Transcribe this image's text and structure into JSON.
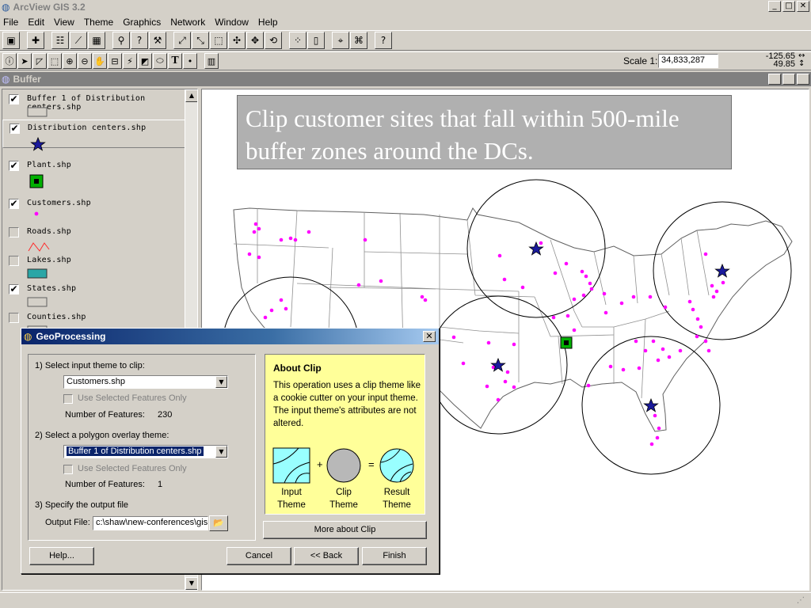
{
  "app": {
    "title": "ArcView GIS 3.2"
  },
  "menu": [
    "File",
    "Edit",
    "View",
    "Theme",
    "Graphics",
    "Network",
    "Window",
    "Help"
  ],
  "toolbar": {
    "scale_label": "Scale 1:",
    "scale_value": "34,833,287",
    "coord_x": "-125.65",
    "coord_y": "49.85"
  },
  "view": {
    "title": "Buffer"
  },
  "toc": {
    "layers": [
      {
        "name": "Buffer 1 of Distribution centers.shp",
        "checked": true,
        "symbol": "box"
      },
      {
        "name": "Distribution centers.shp",
        "checked": true,
        "symbol": "star"
      },
      {
        "name": "Plant.shp",
        "checked": true,
        "symbol": "plant"
      },
      {
        "name": "Customers.shp",
        "checked": true,
        "symbol": "dot"
      },
      {
        "name": "Roads.shp",
        "checked": false,
        "symbol": "road"
      },
      {
        "name": "Lakes.shp",
        "checked": false,
        "symbol": "lake"
      },
      {
        "name": "States.shp",
        "checked": true,
        "symbol": "box"
      },
      {
        "name": "Counties.shp",
        "checked": false,
        "symbol": "box"
      }
    ]
  },
  "map": {
    "banner": "Clip customer sites that fall within 500-mile buffer zones around the DCs."
  },
  "colors": {
    "customer": "#ff00ff",
    "dc_star": "#1a1a9c",
    "plant": "#00b000",
    "buffer_line": "#000000",
    "banner_bg": "#b0b0b0",
    "about_bg": "#ffff99",
    "dialog_title": "#0a246a"
  },
  "dialog": {
    "title": "GeoProcessing",
    "step1": "1) Select input theme to clip:",
    "input_theme": "Customers.shp",
    "use_selected_1": "Use Selected Features Only",
    "num_features_label_1": "Number of Features:",
    "num_features_1": "230",
    "step2": "2) Select a polygon overlay theme:",
    "overlay_theme": "Buffer 1 of Distribution centers.shp",
    "use_selected_2": "Use Selected Features Only",
    "num_features_label_2": "Number of Features:",
    "num_features_2": "1",
    "step3": "3) Specify the output file",
    "output_label": "Output File:",
    "output_value": "c:\\shaw\\new-conferences\\gis",
    "about_title": "About Clip",
    "about_text": "This operation uses a clip theme like a cookie cutter on your input theme.  The input theme's attributes are not altered.",
    "plus": "+",
    "equals": "=",
    "cap_input": "Input Theme",
    "cap_clip": "Clip Theme",
    "cap_result": "Result Theme",
    "more_btn": "More about Clip",
    "help_btn": "Help...",
    "cancel_btn": "Cancel",
    "back_btn": "<< Back",
    "finish_btn": "Finish"
  }
}
